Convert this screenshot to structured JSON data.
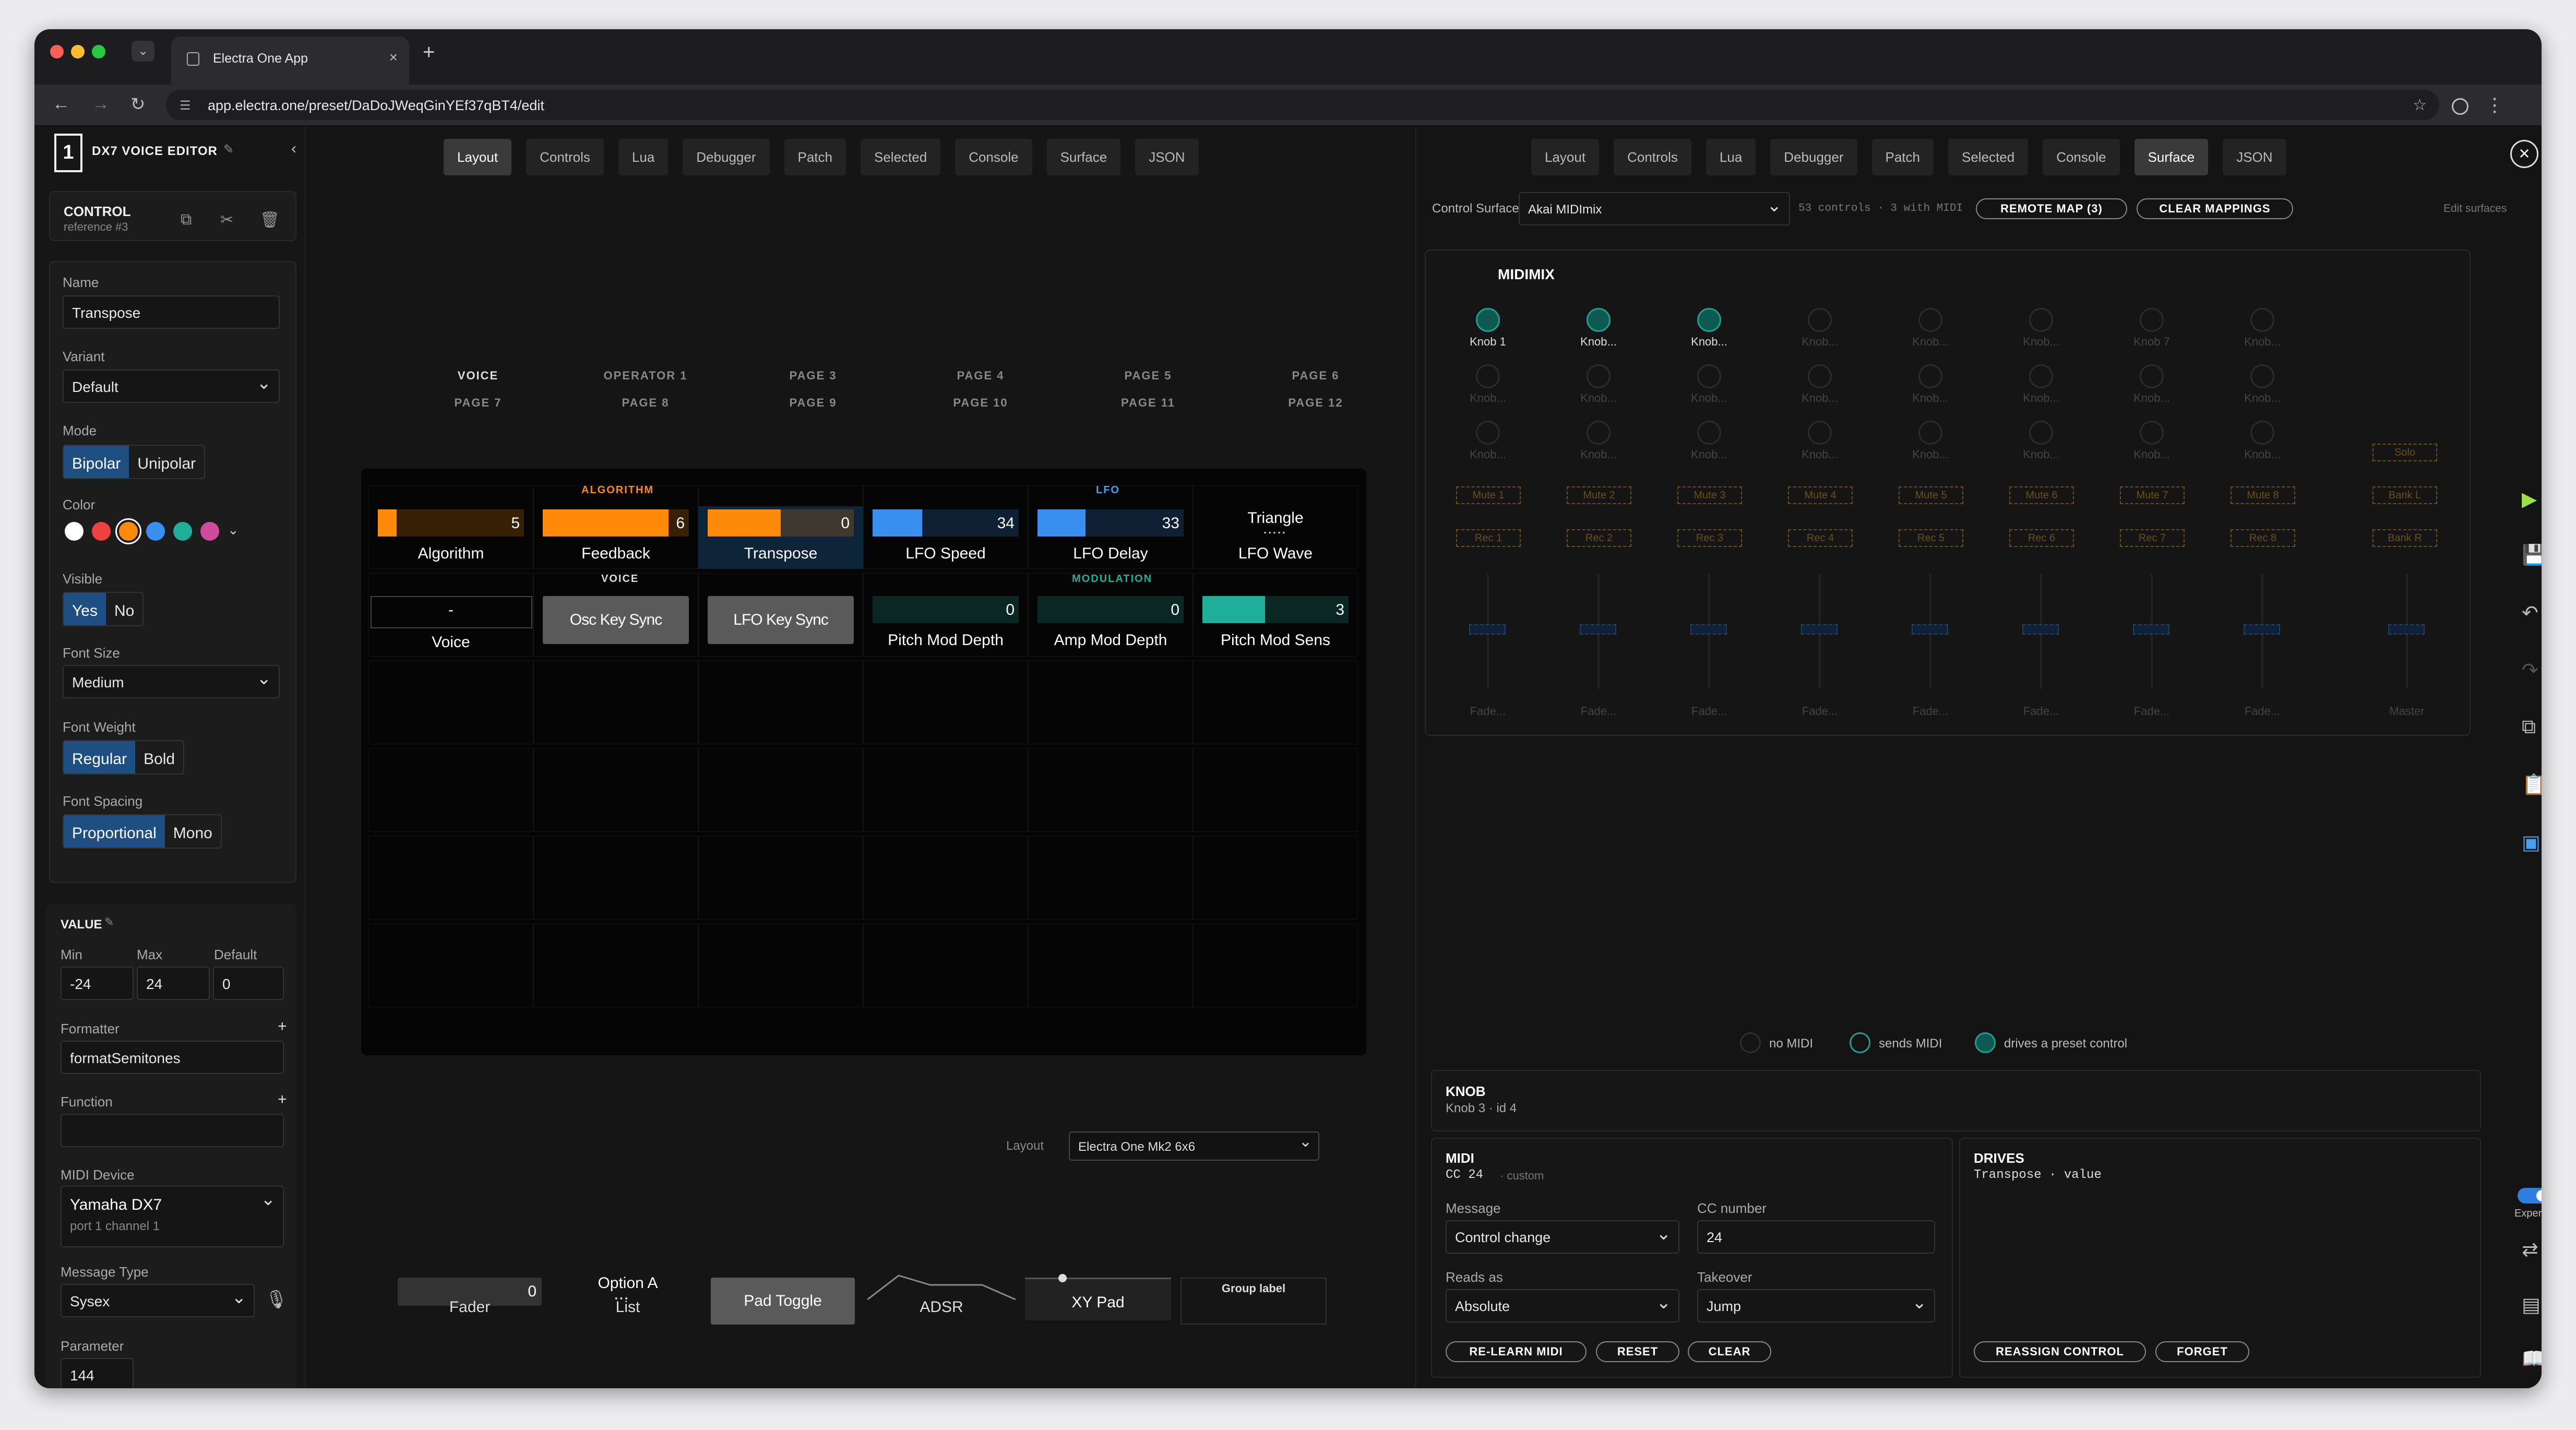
{
  "browser": {
    "tab_title": "Electra One App",
    "url": "app.electra.one/preset/DaDoJWeqGinYEf37qBT4/edit",
    "traffic_colors": [
      "#ff5f57",
      "#febc2e",
      "#28c840"
    ]
  },
  "sidebar": {
    "logo": "1",
    "preset_title": "DX7 VOICE EDITOR",
    "control_header": "CONTROL",
    "control_ref": "reference #3",
    "name_label": "Name",
    "name_value": "Transpose",
    "variant_label": "Variant",
    "variant_value": "Default",
    "mode_label": "Mode",
    "mode_options": [
      "Bipolar",
      "Unipolar"
    ],
    "color_label": "Color",
    "colors": [
      "#ffffff",
      "#f04040",
      "#ff8a0a",
      "#3a8ef0",
      "#1fae9a",
      "#d04aa0"
    ],
    "visible_label": "Visible",
    "visible_options": [
      "Yes",
      "No"
    ],
    "font_size_label": "Font Size",
    "font_size_value": "Medium",
    "font_weight_label": "Font Weight",
    "font_weight_options": [
      "Regular",
      "Bold"
    ],
    "font_spacing_label": "Font Spacing",
    "font_spacing_options": [
      "Proportional",
      "Mono"
    ],
    "value_header": "VALUE",
    "min_label": "Min",
    "max_label": "Max",
    "default_label": "Default",
    "min_value": "-24",
    "max_value": "24",
    "default_value": "0",
    "formatter_label": "Formatter",
    "formatter_value": "formatSemitones",
    "function_label": "Function",
    "function_value": "",
    "midi_device_label": "MIDI Device",
    "midi_device_name": "Yamaha DX7",
    "midi_device_port": "port 1 channel 1",
    "message_type_label": "Message Type",
    "message_type_value": "Sysex",
    "parameter_label": "Parameter",
    "parameter_value": "144",
    "plus": "+"
  },
  "center": {
    "tabs": [
      "Layout",
      "Controls",
      "Lua",
      "Debugger",
      "Patch",
      "Selected",
      "Console",
      "Surface",
      "JSON"
    ],
    "page_row1": [
      "VOICE",
      "OPERATOR 1",
      "PAGE 3",
      "PAGE 4",
      "PAGE 5",
      "PAGE 6"
    ],
    "page_row2": [
      "PAGE 7",
      "PAGE 8",
      "PAGE 9",
      "PAGE 10",
      "PAGE 11",
      "PAGE 12"
    ],
    "group_labels": {
      "algorithm": "ALGORITHM",
      "lfo": "LFO",
      "voice": "VOICE",
      "modulation": "MODULATION"
    },
    "row1": [
      {
        "label": "Algorithm",
        "value": "5",
        "fill": 0.13,
        "color": "#ff8a0a"
      },
      {
        "label": "Feedback",
        "value": "6",
        "fill": 0.86,
        "color": "#ff8a0a"
      },
      {
        "label": "Transpose",
        "value": "0",
        "fill": 0.5,
        "color": "#ff8a0a"
      },
      {
        "label": "LFO Speed",
        "value": "34",
        "fill": 0.34,
        "color": "#3a8ef0"
      },
      {
        "label": "LFO Delay",
        "value": "33",
        "fill": 0.33,
        "color": "#3a8ef0"
      },
      {
        "label": "LFO Wave",
        "value": "Triangle",
        "fill": 0,
        "color": "#ffffff"
      }
    ],
    "row2": [
      {
        "label": "Voice",
        "value": "-"
      },
      {
        "label": "Osc Key Sync"
      },
      {
        "label": "LFO Key Sync"
      },
      {
        "label": "Pitch Mod Depth",
        "value": "0",
        "fill": 0,
        "color": "#1fae9a"
      },
      {
        "label": "Amp Mod Depth",
        "value": "0",
        "fill": 0,
        "color": "#1fae9a"
      },
      {
        "label": "Pitch Mod Sens",
        "value": "3",
        "fill": 0.43,
        "color": "#1fae9a"
      }
    ],
    "layout_label": "Layout",
    "layout_value": "Electra One Mk2 6x6",
    "toolbox": {
      "fader_label": "Fader",
      "fader_value": "0",
      "list_option": "Option A",
      "list_label": "List",
      "pad_label": "Pad Toggle",
      "adsr_label": "ADSR",
      "xy_label": "XY Pad",
      "group_label": "Group label"
    }
  },
  "right": {
    "tabs": [
      "Layout",
      "Controls",
      "Lua",
      "Debugger",
      "Patch",
      "Selected",
      "Console",
      "Surface",
      "JSON"
    ],
    "surface_label": "Control Surface",
    "surface_value": "Akai MIDImix",
    "surface_stats": "53 controls · 3 with MIDI",
    "remote_map_button": "REMOTE MAP (3)",
    "clear_mappings_button": "CLEAR MAPPINGS",
    "edit_surfaces_link": "Edit surfaces",
    "device_title": "MIDIMIX",
    "knob_labels_row1": [
      "Knob 1",
      "Knob...",
      "Knob...",
      "Knob...",
      "Knob...",
      "Knob...",
      "Knob 7",
      "Knob..."
    ],
    "knob_labels_row2": [
      "Knob...",
      "Knob...",
      "Knob...",
      "Knob...",
      "Knob...",
      "Knob...",
      "Knob...",
      "Knob..."
    ],
    "knob_labels_row3": [
      "Knob...",
      "Knob...",
      "Knob...",
      "Knob...",
      "Knob...",
      "Knob...",
      "Knob...",
      "Knob..."
    ],
    "mute_labels": [
      "Mute 1",
      "Mute 2",
      "Mute 3",
      "Mute 4",
      "Mute 5",
      "Mute 6",
      "Mute 7",
      "Mute 8"
    ],
    "rec_labels": [
      "Rec 1",
      "Rec 2",
      "Rec 3",
      "Rec 4",
      "Rec 5",
      "Rec 6",
      "Rec 7",
      "Rec 8"
    ],
    "solo_label": "Solo",
    "bank_l_label": "Bank L",
    "bank_r_label": "Bank R",
    "fader_labels": [
      "Fade...",
      "Fade...",
      "Fade...",
      "Fade...",
      "Fade...",
      "Fade...",
      "Fade...",
      "Fade...",
      "Master"
    ],
    "legend": [
      "no MIDI",
      "sends MIDI",
      "drives a preset control"
    ],
    "knob_header": "KNOB",
    "knob_sub": "Knob 3 · id 4",
    "midi_header": "MIDI",
    "midi_sub_cc": "CC 24",
    "midi_sub_custom": "· custom",
    "message_label": "Message",
    "message_value": "Control change",
    "cc_label": "CC number",
    "cc_value": "24",
    "reads_label": "Reads as",
    "reads_value": "Absolute",
    "takeover_label": "Takeover",
    "takeover_value": "Jump",
    "relearn_button": "RE-LEARN MIDI",
    "reset_button": "RESET",
    "clear_button": "CLEAR",
    "drives_header": "DRIVES",
    "drives_value": "Transpose · value",
    "reassign_button": "REASSIGN CONTROL",
    "forget_button": "FORGET",
    "expert_label": "Expert"
  }
}
